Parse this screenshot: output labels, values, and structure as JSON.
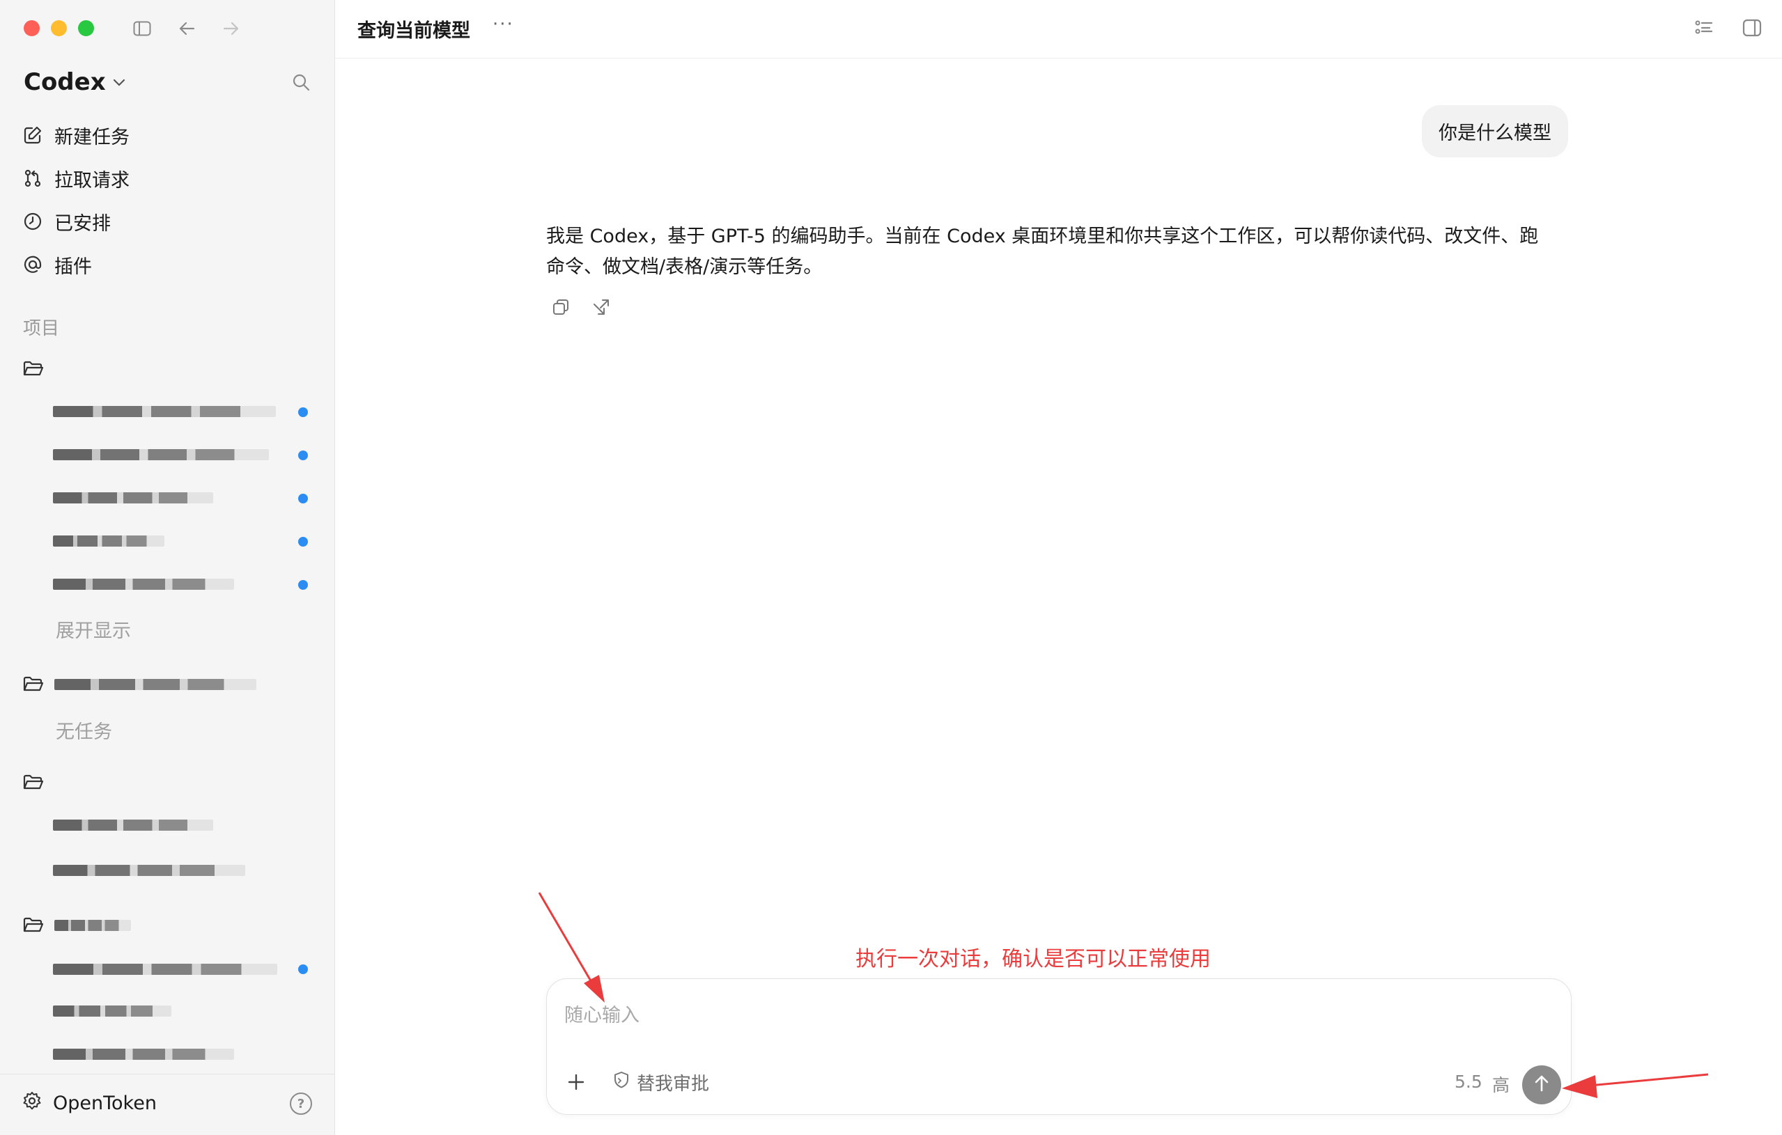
{
  "window": {
    "title": "查询当前模型",
    "more_label": "···"
  },
  "sidebar": {
    "brand": "Codex",
    "nav": [
      {
        "label": "新建任务",
        "icon": "edit-icon"
      },
      {
        "label": "拉取请求",
        "icon": "pull-request-icon"
      },
      {
        "label": "已安排",
        "icon": "clock-icon"
      },
      {
        "label": "插件",
        "icon": "at-icon"
      }
    ],
    "section_label": "项目",
    "expand_label": "展开显示",
    "no_tasks_label": "无任务",
    "account_label": "OpenToken",
    "help_label": "?"
  },
  "conversation": {
    "user_message": "你是什么模型",
    "assistant_message": "我是 Codex，基于 GPT-5 的编码助手。当前在 Codex 桌面环境里和你共享这个工作区，可以帮你读代码、改文件、跑命令、做文档/表格/演示等任务。"
  },
  "annotation": {
    "text": "执行一次对话，确认是否可以正常使用",
    "color": "#ea3c3c"
  },
  "composer": {
    "placeholder": "随心输入",
    "approve_label": "替我审批",
    "model_label": "5.5",
    "effort_label": "高"
  },
  "colors": {
    "accent_dot": "#2b8cf2",
    "send_button": "#8a8a8a",
    "sidebar_bg": "#f5f5f5"
  }
}
